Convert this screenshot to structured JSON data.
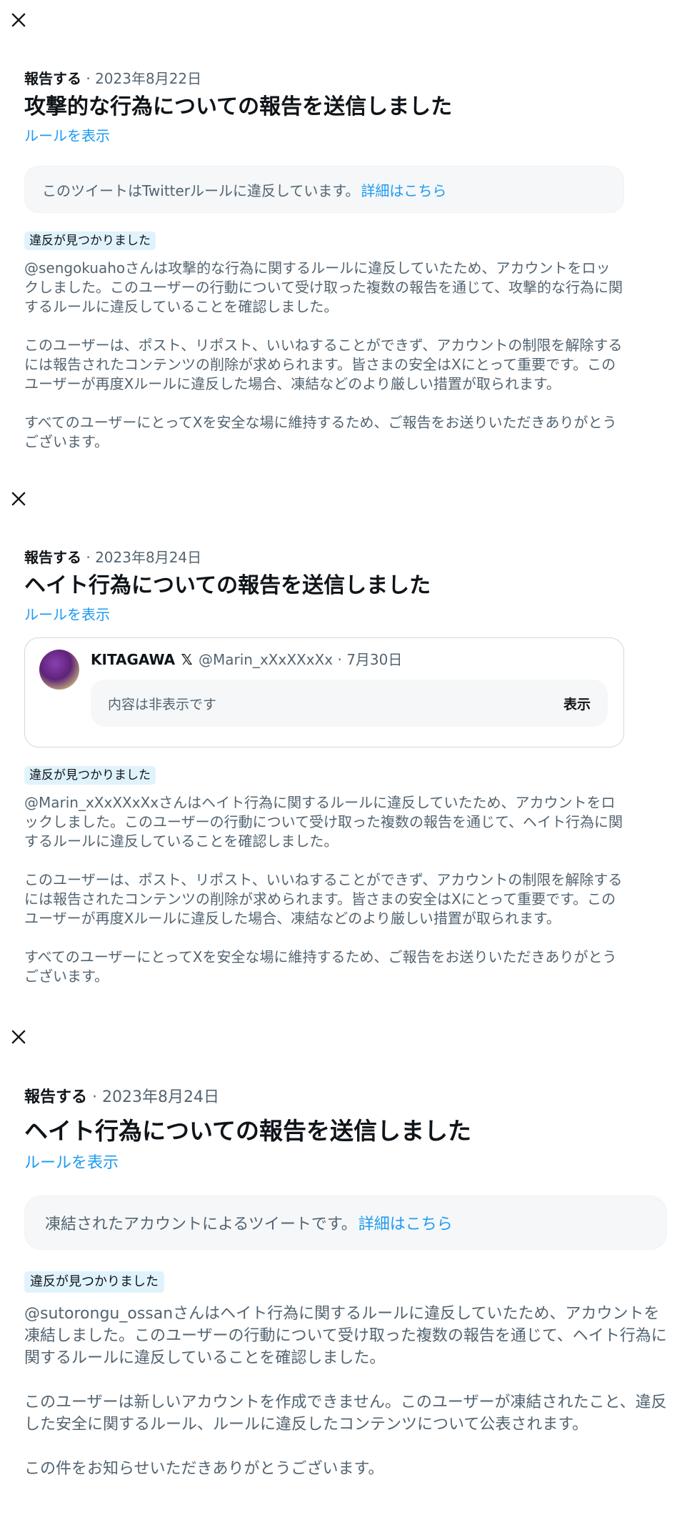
{
  "reports": [
    {
      "meta_label": "報告する",
      "date": "· 2023年8月22日",
      "title": "攻撃的な行為についての報告を送信しました",
      "rules_link": "ルールを表示",
      "notice_text": "このツイートはTwitterルールに違反しています。",
      "notice_link": "詳細はこちら",
      "badge": "違反が見つかりました",
      "paragraphs": [
        "@sengokuahoさんは攻撃的な行為に関するルールに違反していたため、アカウントをロックしました。このユーザーの行動について受け取った複数の報告を通じて、攻撃的な行為に関するルールに違反していることを確認しました。",
        "このユーザーは、ポスト、リポスト、いいねすることができず、アカウントの制限を解除するには報告されたコンテンツの削除が求められます。皆さまの安全はXにとって重要です。このユーザーが再度Xルールに違反した場合、凍結などのより厳しい措置が取られます。",
        "すべてのユーザーにとってXを安全な場に維持するため、ご報告をお送りいただきありがとうございます。"
      ]
    },
    {
      "meta_label": "報告する",
      "date": "· 2023年8月24日",
      "title": "ヘイト行為についての報告を送信しました",
      "rules_link": "ルールを表示",
      "tweet": {
        "name": "KITAGAWA",
        "x_mark": "𝕏",
        "handle": "@Marin_xXxXXxXx",
        "date": "· 7月30日",
        "hidden_text": "内容は非表示です",
        "show_label": "表示"
      },
      "badge": "違反が見つかりました",
      "paragraphs": [
        "@Marin_xXxXXxXxさんはヘイト行為に関するルールに違反していたため、アカウントをロックしました。このユーザーの行動について受け取った複数の報告を通じて、ヘイト行為に関するルールに違反していることを確認しました。",
        "このユーザーは、ポスト、リポスト、いいねすることができず、アカウントの制限を解除するには報告されたコンテンツの削除が求められます。皆さまの安全はXにとって重要です。このユーザーが再度Xルールに違反した場合、凍結などのより厳しい措置が取られます。",
        "すべてのユーザーにとってXを安全な場に維持するため、ご報告をお送りいただきありがとうございます。"
      ]
    },
    {
      "meta_label": "報告する",
      "date": "· 2023年8月24日",
      "title": "ヘイト行為についての報告を送信しました",
      "rules_link": "ルールを表示",
      "notice_text": "凍結されたアカウントによるツイートです。",
      "notice_link": "詳細はこちら",
      "badge": "違反が見つかりました",
      "paragraphs": [
        "@sutorongu_ossanさんはヘイト行為に関するルールに違反していたため、アカウントを凍結しました。このユーザーの行動について受け取った複数の報告を通じて、ヘイト行為に関するルールに違反していることを確認しました。",
        "このユーザーは新しいアカウントを作成できません。このユーザーが凍結されたこと、違反した安全に関するルール、ルールに違反したコンテンツについて公表されます。",
        "この件をお知らせいただきありがとうございます。"
      ]
    }
  ]
}
